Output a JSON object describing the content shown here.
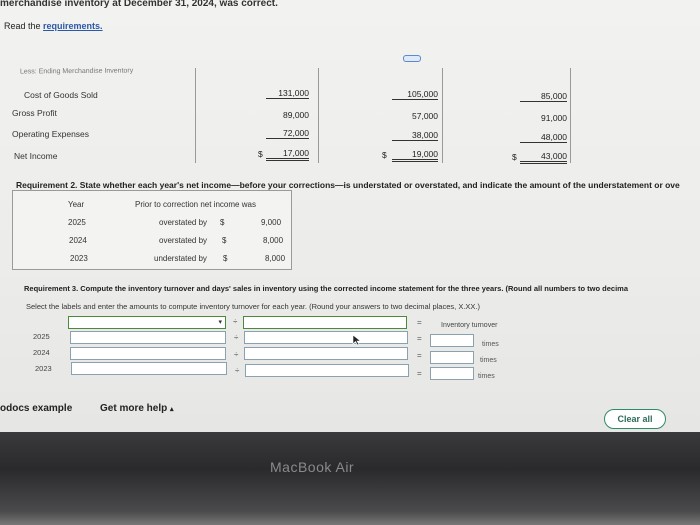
{
  "header": {
    "top_text": "merchandise inventory at December 31, 2024, was correct.",
    "read_prefix": "Read the ",
    "read_link": "requirements."
  },
  "statement": {
    "partial_row": "Less: Ending Merchandise Inventory",
    "rows": [
      {
        "label": "Cost of Goods Sold",
        "v2025": "131,000",
        "v2024": "105,000",
        "v2023": "85,000"
      },
      {
        "label": "Gross Profit",
        "v2025": "89,000",
        "v2024": "57,000",
        "v2023": "91,000"
      },
      {
        "label": "Operating Expenses",
        "v2025": "72,000",
        "v2024": "38,000",
        "v2023": "48,000"
      },
      {
        "label": "Net Income",
        "v2025": "17,000",
        "v2024": "19,000",
        "v2023": "43,000"
      }
    ],
    "dollar": "$"
  },
  "req2": {
    "title": "Requirement 2. State whether each year's net income—before your corrections—is understated or overstated, and indicate the amount of the understatement or ove",
    "col_year": "Year",
    "col_prior": "Prior to correction net income was",
    "rows": [
      {
        "year": "2025",
        "status": "overstated by",
        "dollar": "$",
        "amount": "9,000"
      },
      {
        "year": "2024",
        "status": "overstated by",
        "dollar": "$",
        "amount": "8,000"
      },
      {
        "year": "2023",
        "status": "understated by",
        "dollar": "$",
        "amount": "8,000"
      }
    ]
  },
  "req3": {
    "title": "Requirement 3. Compute the inventory turnover and days' sales in inventory using the corrected income statement for the three years. (Round all numbers to two decima",
    "instructions": "Select the labels and enter the amounts to compute inventory turnover for each year. (Round your answers to two decimal places, X.XX.)",
    "header_result": "Inventory turnover",
    "years": [
      "2025",
      "2024",
      "2023"
    ],
    "unit": "times",
    "divide_symbol": "÷",
    "equals_symbol": "="
  },
  "footer": {
    "example_link": "odocs example",
    "help_link": "Get more help",
    "help_caret": "▴",
    "clear_button": "Clear all"
  },
  "device": {
    "brand": "MacBook Air"
  }
}
